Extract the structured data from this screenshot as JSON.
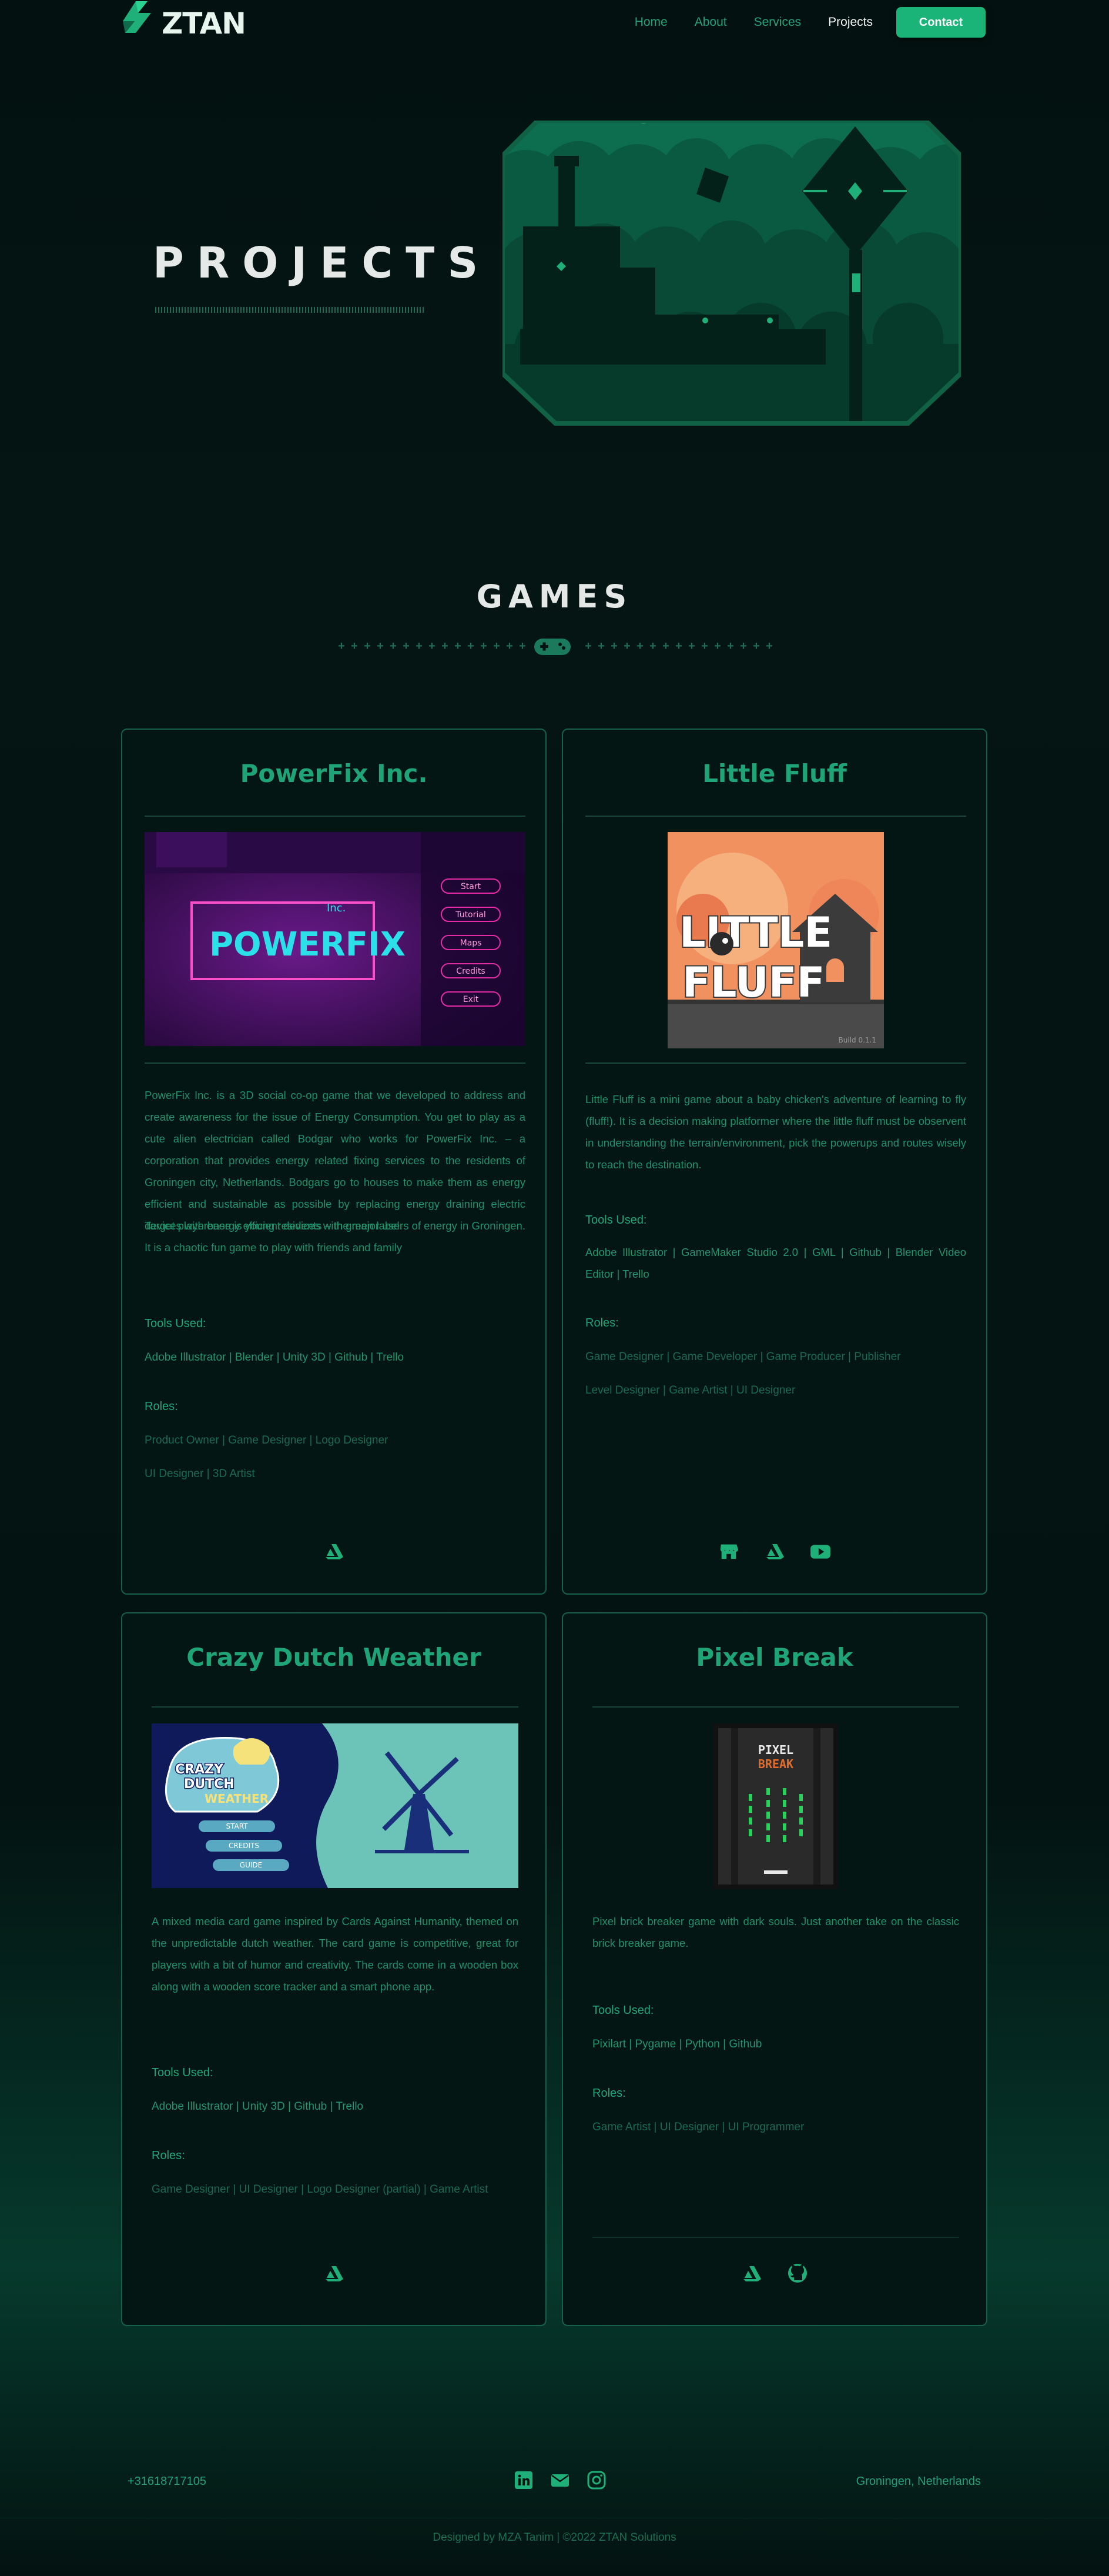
{
  "brand": {
    "name": "ZTAN"
  },
  "nav": {
    "links": [
      {
        "label": "Home"
      },
      {
        "label": "About"
      },
      {
        "label": "Services"
      },
      {
        "label": "Projects"
      }
    ],
    "contact_label": "Contact"
  },
  "hero": {
    "title": "PROJECTS"
  },
  "games": {
    "title": "GAMES",
    "cards": [
      {
        "title": "PowerFix Inc.",
        "description": "PowerFix Inc. is a 3D social co-op game that we developed to address and create awareness for the issue of Energy Consumption. You get to play as a cute alien electrician called Bodgar who works for PowerFix Inc. – a corporation that provides energy related fixing services to the residents of Groningen city, Netherlands. Bodgars go to houses to make them as energy efficient and sustainable as possible by replacing energy draining electric devices with energy efficient devices with green label.",
        "description2": "Target playerbase is young residents – the major users of energy in Groningen. It is a chaotic fun game to play with friends and family",
        "tools_label": "Tools Used:",
        "tools": "Adobe Illustrator | Blender | Unity 3D | Github | Trello",
        "roles_label": "Roles:",
        "roles": [
          "Product Owner | Game Designer | Logo Designer",
          "UI Designer | 3D Artist"
        ],
        "thumbnail": {
          "logo_text": "POWERFIX",
          "inc_text": "Inc.",
          "menu": [
            "Start",
            "Tutorial",
            "Maps",
            "Credits",
            "Exit"
          ]
        },
        "icons": [
          "artstation-icon"
        ]
      },
      {
        "title": "Little Fluff",
        "description": "Little Fluff is a mini game about a baby chicken's adventure of learning to fly (fluff!). It is a decision making platformer where the little fluff must be observent in understanding the terrain/environment, pick the powerups and routes wisely to reach the destination.",
        "tools_label": "Tools Used:",
        "tools": "Adobe Illustrator | GameMaker Studio 2.0 | GML | Github | Blender Video Editor | Trello",
        "roles_label": "Roles:",
        "roles": [
          "Game Designer | Game Developer | Game Producer | Publisher",
          "Level Designer | Game Artist | UI Designer"
        ],
        "thumbnail": {
          "logo_line1": "LITTLE",
          "logo_line2": "FLUFF",
          "build": "Build 0.1.1"
        },
        "icons": [
          "store-icon",
          "artstation-icon",
          "youtube-icon"
        ]
      },
      {
        "title": "Crazy Dutch Weather",
        "description": "A mixed media card game inspired by Cards Against Humanity, themed on the unpredictable dutch weather. The card game is competitive, great for players with a bit of humor and creativity. The cards come in a wooden box along with a wooden score tracker and a smart phone app.",
        "tools_label": "Tools Used:",
        "tools": "Adobe Illustrator | Unity 3D | Github | Trello",
        "roles_label": "Roles:",
        "roles": [
          "Game Designer | UI Designer | Logo Designer (partial) | Game Artist"
        ],
        "thumbnail": {
          "logo_line1": "CRAZY",
          "logo_line2": "DUTCH",
          "logo_line3": "WEATHER",
          "menu": [
            "START",
            "CREDITS",
            "GUIDE"
          ]
        },
        "icons": [
          "artstation-icon"
        ]
      },
      {
        "title": "Pixel Break",
        "description": "Pixel brick breaker game with dark souls. Just another take on the classic brick breaker game.",
        "tools_label": "Tools Used:",
        "tools": "Pixilart | Pygame | Python | Github",
        "roles_label": "Roles:",
        "roles": [
          "Game Artist | UI Designer | UI Programmer"
        ],
        "thumbnail": {
          "logo_line1": "PIXEL",
          "logo_line2": "BREAK"
        },
        "icons": [
          "artstation-icon",
          "github-icon"
        ]
      }
    ]
  },
  "footer": {
    "phone": "+31618717105",
    "location": "Groningen, Netherlands",
    "credit": "Designed by MZA Tanim  |  ©2022 ZTAN Solutions",
    "icons": [
      "linkedin-icon",
      "email-icon",
      "instagram-icon"
    ]
  },
  "colors": {
    "accent": "#1ab378",
    "accent_text": "#1fa478",
    "background": "#031311",
    "border": "#16614a"
  }
}
